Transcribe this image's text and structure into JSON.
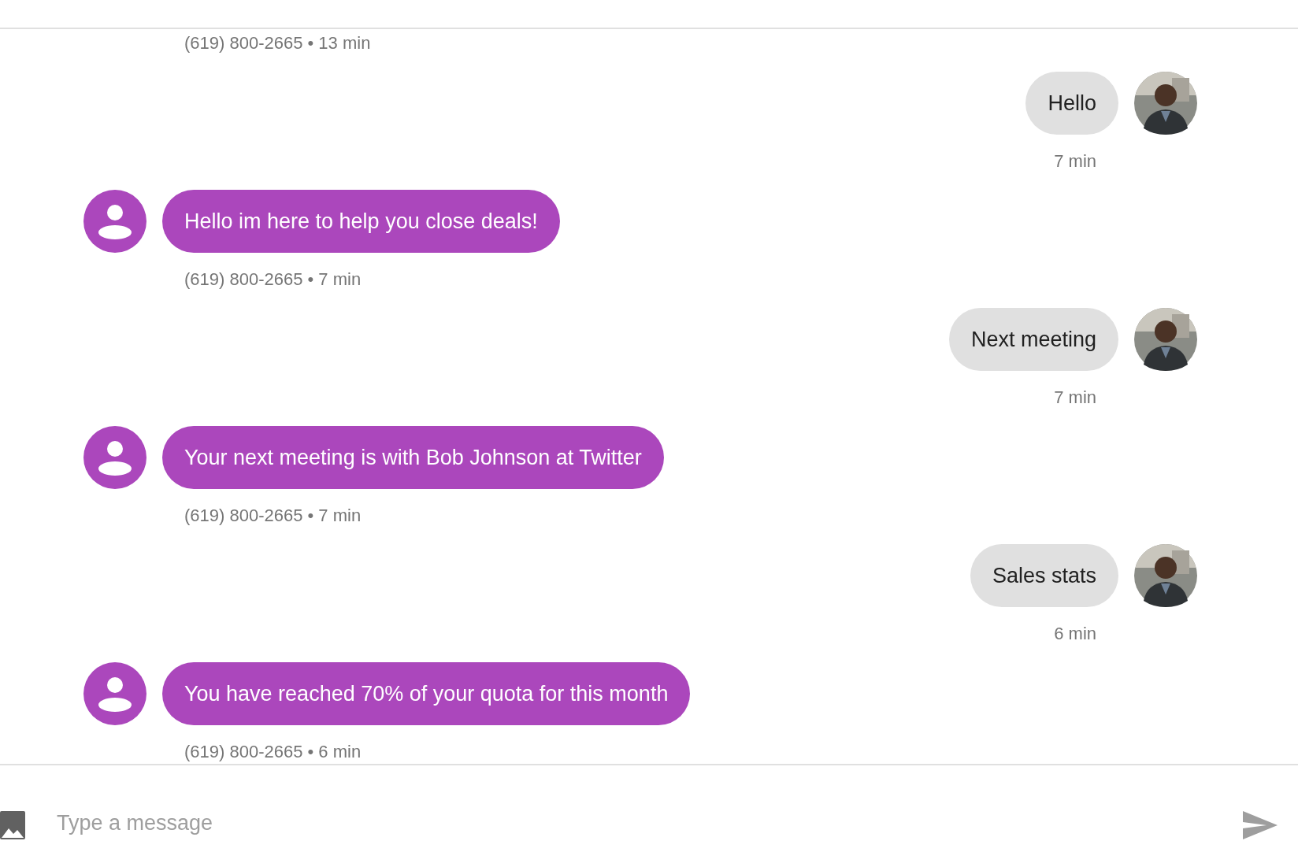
{
  "earlier_meta": "(619) 800-2665 • 13 min",
  "messages": [
    {
      "kind": "outgoing",
      "text": "Hello",
      "meta": "7 min"
    },
    {
      "kind": "incoming",
      "text": "Hello im here to help you close deals!",
      "meta": "(619) 800-2665 • 7 min"
    },
    {
      "kind": "outgoing",
      "text": "Next meeting",
      "meta": "7 min"
    },
    {
      "kind": "incoming",
      "text": "Your next meeting is with Bob Johnson at Twitter",
      "meta": "(619) 800-2665 • 7 min"
    },
    {
      "kind": "outgoing",
      "text": "Sales stats",
      "meta": "6 min"
    },
    {
      "kind": "incoming",
      "text": "You have reached 70% of your quota for this month",
      "meta": "(619) 800-2665 • 6 min"
    }
  ],
  "composer": {
    "placeholder": "Type a message"
  }
}
